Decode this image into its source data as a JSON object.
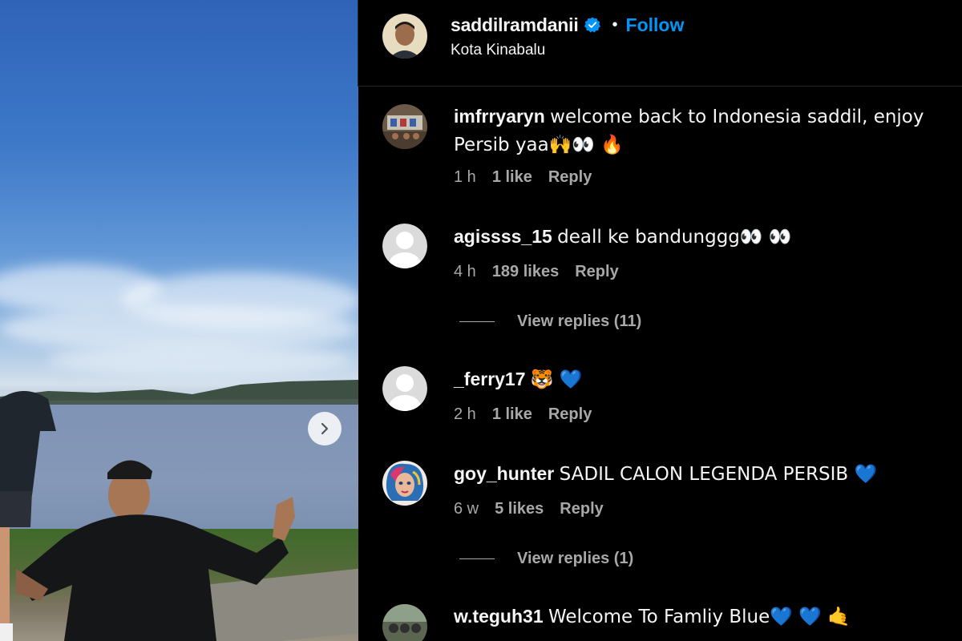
{
  "post": {
    "username": "saddilramdanii",
    "verified": true,
    "separator": "•",
    "follow_label": "Follow",
    "location": "Kota Kinabalu"
  },
  "comments": [
    {
      "username": "imfrryaryn",
      "text": "welcome back to Indonesia saddil, enjoy Persib yaa🙌👀 🔥",
      "time": "1 h",
      "likes": "1 like",
      "reply_label": "Reply",
      "avatar": "photo-avatar"
    },
    {
      "username": "agissss_15",
      "text": "deall ke bandunggg👀 👀",
      "time": "4 h",
      "likes": "189 likes",
      "reply_label": "Reply",
      "avatar": "default-avatar",
      "view_replies": "View replies (11)"
    },
    {
      "username": "_ferry17",
      "text": "🐯 💙",
      "time": "2 h",
      "likes": "1 like",
      "reply_label": "Reply",
      "avatar": "default-avatar"
    },
    {
      "username": "goy_hunter",
      "text": "SADIL CALON LEGENDA PERSIB 💙",
      "time": "6 w",
      "likes": "5 likes",
      "reply_label": "Reply",
      "avatar": "illustrated-avatar",
      "view_replies": "View replies (1)"
    },
    {
      "username": "w.teguh31",
      "text": "Welcome To Famliy Blue💙 💙 🤙",
      "avatar": "photo-avatar"
    }
  ],
  "colors": {
    "background": "#000000",
    "text": "#f5f5f5",
    "secondary_text": "#a8a8a8",
    "follow_blue": "#0095f6",
    "verified_blue": "#0095f6"
  },
  "icons": {
    "carousel_next": "chevron-right-icon",
    "verified": "verified-badge-icon"
  }
}
